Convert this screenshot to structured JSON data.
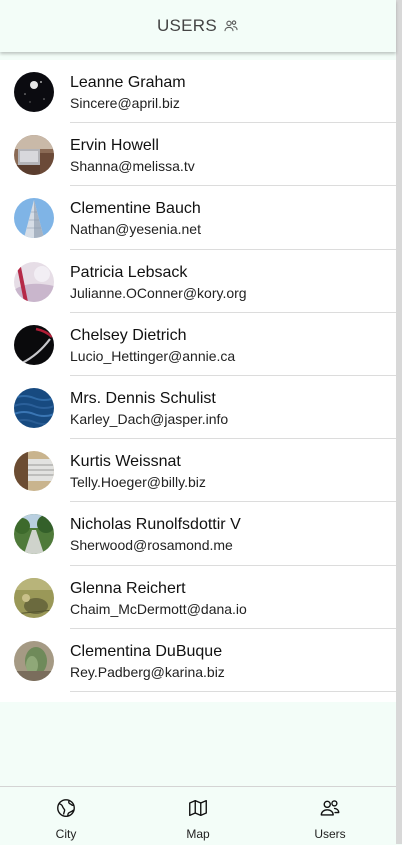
{
  "header": {
    "title": "USERS",
    "icon": "users-icon"
  },
  "users": [
    {
      "name": "Leanne Graham",
      "email": "Sincere@april.biz",
      "avatar": "night-photo"
    },
    {
      "name": "Ervin Howell",
      "email": "Shanna@melissa.tv",
      "avatar": "laptop-photo"
    },
    {
      "name": "Clementine Bauch",
      "email": "Nathan@yesenia.net",
      "avatar": "building-photo"
    },
    {
      "name": "Patricia Lebsack",
      "email": "Julianne.OConner@kory.org",
      "avatar": "abstract-photo"
    },
    {
      "name": "Chelsey Dietrich",
      "email": "Lucio_Hettinger@annie.ca",
      "avatar": "dark-photo"
    },
    {
      "name": "Mrs. Dennis Schulist",
      "email": "Karley_Dach@jasper.info",
      "avatar": "water-photo"
    },
    {
      "name": "Kurtis Weissnat",
      "email": "Telly.Hoeger@billy.biz",
      "avatar": "keyboard-photo"
    },
    {
      "name": "Nicholas Runolfsdottir V",
      "email": "Sherwood@rosamond.me",
      "avatar": "path-photo"
    },
    {
      "name": "Glenna Reichert",
      "email": "Chaim_McDermott@dana.io",
      "avatar": "field-photo"
    },
    {
      "name": "Clementina DuBuque",
      "email": "Rey.Padberg@karina.biz",
      "avatar": "plant-photo"
    }
  ],
  "tabs": [
    {
      "label": "City",
      "icon": "globe-icon"
    },
    {
      "label": "Map",
      "icon": "map-icon"
    },
    {
      "label": "Users",
      "icon": "users-icon"
    }
  ],
  "colors": {
    "background": "#f3fdf8",
    "list_background": "#ffffff",
    "divider": "#dcdcdc",
    "text": "#111111"
  }
}
